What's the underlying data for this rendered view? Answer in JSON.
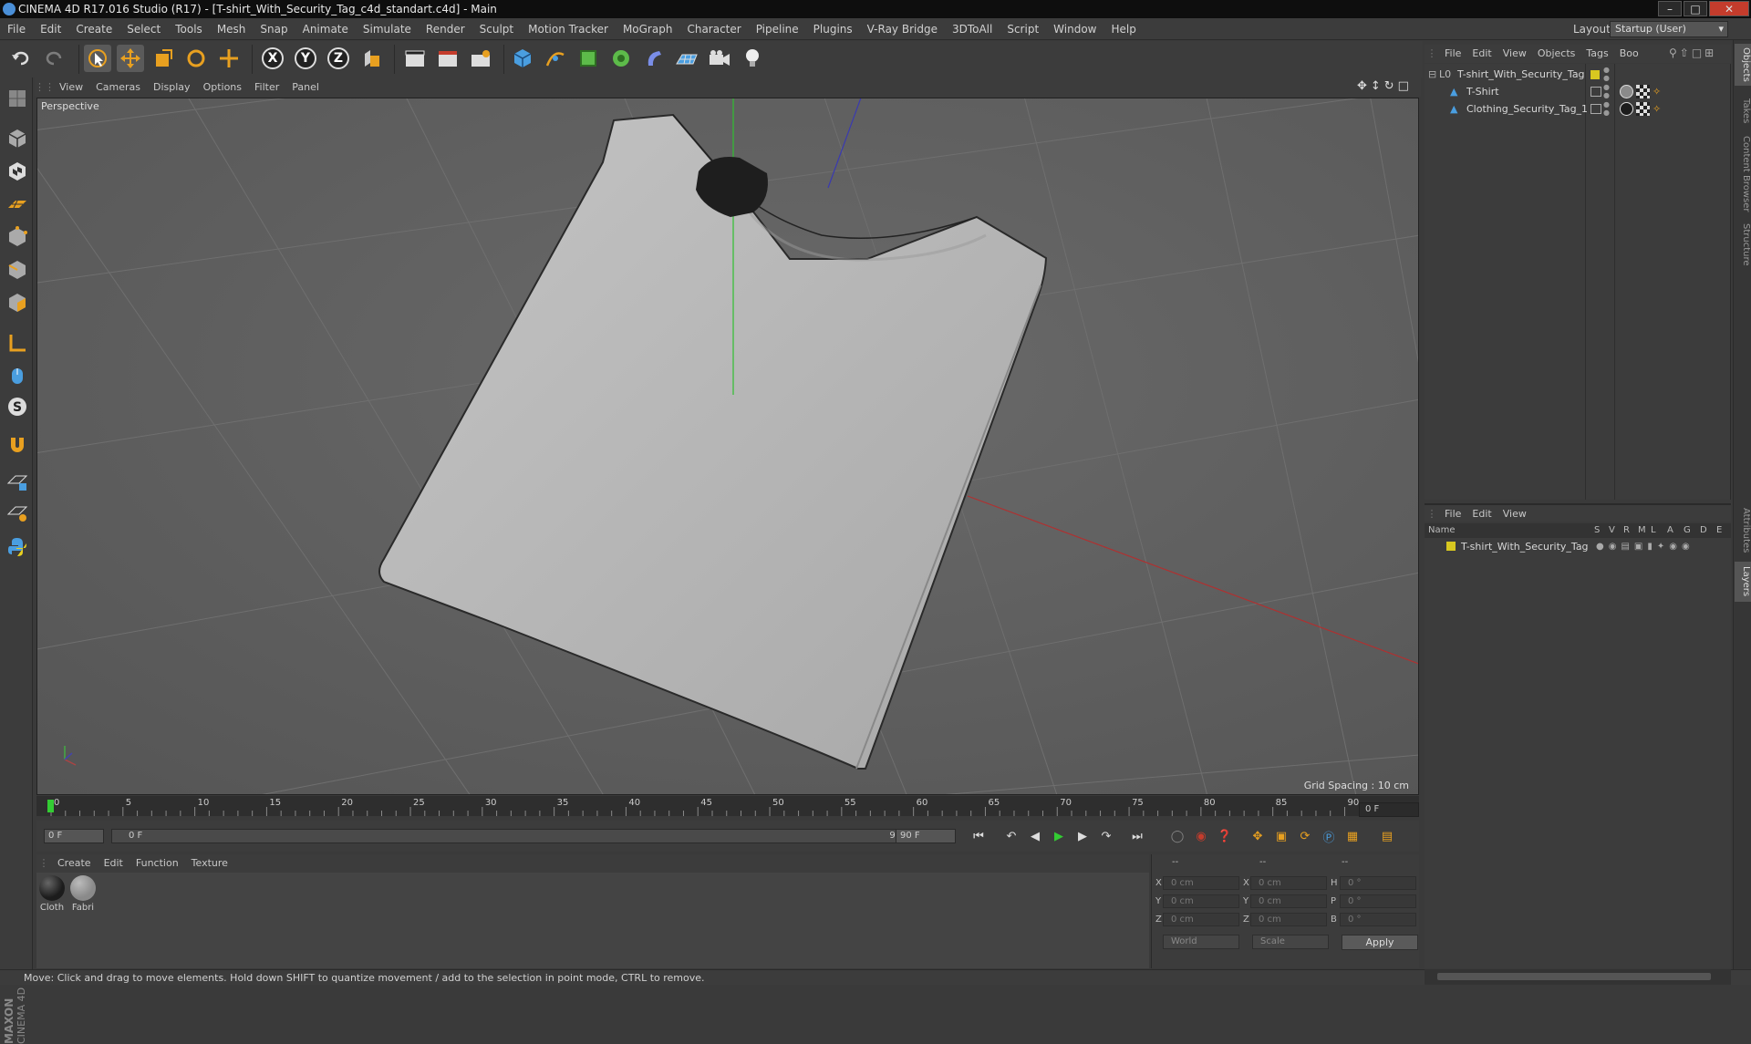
{
  "titlebar": {
    "title": "CINEMA 4D R17.016 Studio (R17) - [T-shirt_With_Security_Tag_c4d_standart.c4d] - Main"
  },
  "menu": [
    "File",
    "Edit",
    "Create",
    "Select",
    "Tools",
    "Mesh",
    "Snap",
    "Animate",
    "Simulate",
    "Render",
    "Sculpt",
    "Motion Tracker",
    "MoGraph",
    "Character",
    "Pipeline",
    "Plugins",
    "V-Ray Bridge",
    "3DToAll",
    "Script",
    "Window",
    "Help"
  ],
  "layout": {
    "label": "Layout:",
    "value": "Startup (User)"
  },
  "toolbar": {
    "axis_x": "X",
    "axis_y": "Y",
    "axis_z": "Z"
  },
  "viewport": {
    "menu": [
      "View",
      "Cameras",
      "Display",
      "Options",
      "Filter",
      "Panel"
    ],
    "label": "Perspective",
    "grid_spacing": "Grid Spacing : 10 cm"
  },
  "timeline": {
    "ticks": [
      "0",
      "5",
      "10",
      "15",
      "20",
      "25",
      "30",
      "35",
      "40",
      "45",
      "50",
      "55",
      "60",
      "65",
      "70",
      "75",
      "80",
      "85",
      "90"
    ],
    "current_frame": "0 F",
    "start_field": "0 F",
    "range_start": "0 F",
    "range_end": "90 F",
    "end_field": "90 F"
  },
  "material_manager": {
    "menu": [
      "Create",
      "Edit",
      "Function",
      "Texture"
    ],
    "materials": [
      {
        "name": "Cloth",
        "color": "#1c1c1c"
      },
      {
        "name": "Fabri",
        "color": "#8a8a8a"
      }
    ]
  },
  "coordinates": {
    "headers": [
      "--",
      "--",
      "--"
    ],
    "rows": [
      {
        "a": "X",
        "a_val": "0 cm",
        "b": "X",
        "b_val": "0 cm",
        "c": "H",
        "c_val": "0 °"
      },
      {
        "a": "Y",
        "a_val": "0 cm",
        "b": "Y",
        "b_val": "0 cm",
        "c": "P",
        "c_val": "0 °"
      },
      {
        "a": "Z",
        "a_val": "0 cm",
        "b": "Z",
        "b_val": "0 cm",
        "c": "B",
        "c_val": "0 °"
      }
    ],
    "mode": "World",
    "scale": "Scale",
    "apply": "Apply"
  },
  "object_manager": {
    "menu": [
      "File",
      "Edit",
      "View",
      "Objects",
      "Tags",
      "Boo"
    ],
    "items": [
      {
        "name": "T-shirt_With_Security_Tag",
        "level": 0
      },
      {
        "name": "T-Shirt",
        "level": 1
      },
      {
        "name": "Clothing_Security_Tag_1",
        "level": 1
      }
    ]
  },
  "layer_manager": {
    "menu": [
      "File",
      "Edit",
      "View"
    ],
    "columns": [
      "Name",
      "S",
      "V",
      "R",
      "M",
      "L",
      "A",
      "G",
      "D",
      "E"
    ],
    "layers": [
      {
        "name": "T-shirt_With_Security_Tag",
        "color": "#d8c820"
      }
    ]
  },
  "right_tabs": [
    "Objects",
    "Takes",
    "Content Browser",
    "Structure",
    "Attributes",
    "Layers"
  ],
  "status": "Move: Click and drag to move elements. Hold down SHIFT to quantize movement / add to the selection in point mode, CTRL to remove.",
  "brand": {
    "line1": "MAXON",
    "line2": "CINEMA 4D"
  },
  "colors": {
    "accent_orange": "#e8a020",
    "object_yellow": "#d8c820",
    "viewport_bg": "#5e5e5e"
  }
}
